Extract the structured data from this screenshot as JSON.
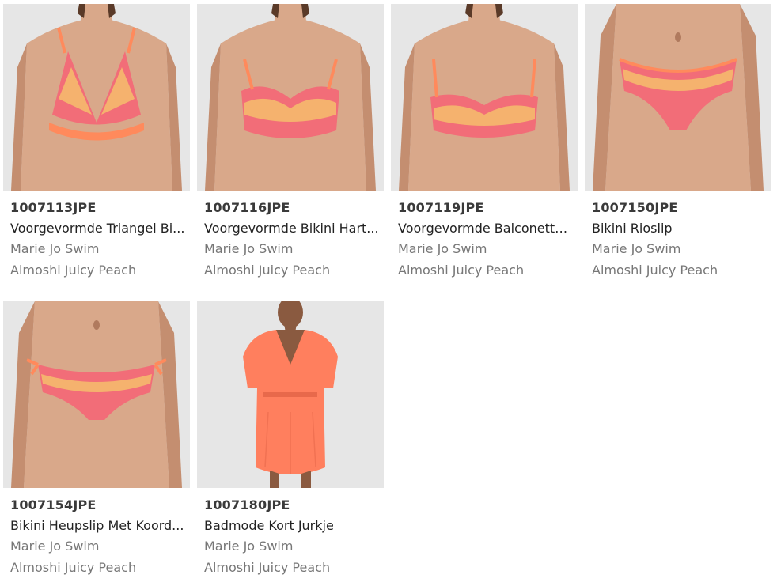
{
  "colors": {
    "photo_bg": "#e6e6e6",
    "skin": "#d9a88a",
    "skin_shadow": "#c48e70",
    "swim_peach": "#ff8a5c",
    "swim_pink": "#f26d78",
    "swim_yellow": "#f5c36b",
    "dress": "#ff7f5e",
    "hair": "#5a3a28"
  },
  "products": [
    {
      "code": "1007113JPE",
      "name": "Voorgevormde Triangel Bi...",
      "brand": "Marie Jo Swim",
      "color": "Almoshi Juicy Peach",
      "image": "triangle-bikini-top-photo"
    },
    {
      "code": "1007116JPE",
      "name": "Voorgevormde Bikini Hart...",
      "brand": "Marie Jo Swim",
      "color": "Almoshi Juicy Peach",
      "image": "heart-shape-bikini-top-photo"
    },
    {
      "code": "1007119JPE",
      "name": "Voorgevormde Balconette...",
      "brand": "Marie Jo Swim",
      "color": "Almoshi Juicy Peach",
      "image": "balconette-bikini-top-photo"
    },
    {
      "code": "1007150JPE",
      "name": "Bikini Rioslip",
      "brand": "Marie Jo Swim",
      "color": "Almoshi Juicy Peach",
      "image": "rio-bikini-brief-photo"
    },
    {
      "code": "1007154JPE",
      "name": "Bikini Heupslip Met Koord...",
      "brand": "Marie Jo Swim",
      "color": "Almoshi Juicy Peach",
      "image": "tie-side-bikini-brief-photo"
    },
    {
      "code": "1007180JPE",
      "name": "Badmode Kort Jurkje",
      "brand": "Marie Jo Swim",
      "color": "Almoshi Juicy Peach",
      "image": "short-beach-dress-photo"
    }
  ]
}
